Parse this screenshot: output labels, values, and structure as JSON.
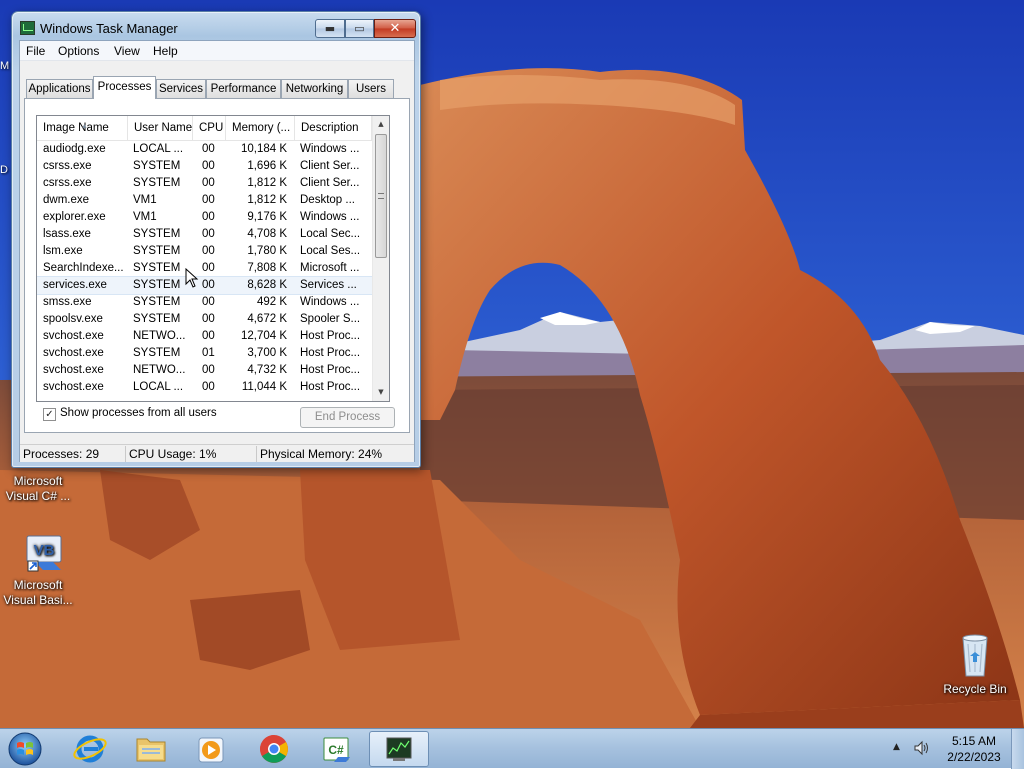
{
  "window": {
    "title": "Windows Task Manager",
    "min_glyph": "▬",
    "max_glyph": "▭",
    "close_glyph": "✕"
  },
  "menu": [
    "File",
    "Options",
    "View",
    "Help"
  ],
  "tabs": [
    "Applications",
    "Processes",
    "Services",
    "Performance",
    "Networking",
    "Users"
  ],
  "active_tab": "Processes",
  "columns": [
    "Image Name",
    "User Name",
    "CPU",
    "Memory (...",
    "Description"
  ],
  "processes": [
    {
      "name": "audiodg.exe",
      "user": "LOCAL ...",
      "cpu": "00",
      "mem": "10,184 K",
      "desc": "Windows ..."
    },
    {
      "name": "csrss.exe",
      "user": "SYSTEM",
      "cpu": "00",
      "mem": "1,696 K",
      "desc": "Client Ser..."
    },
    {
      "name": "csrss.exe",
      "user": "SYSTEM",
      "cpu": "00",
      "mem": "1,812 K",
      "desc": "Client Ser..."
    },
    {
      "name": "dwm.exe",
      "user": "VM1",
      "cpu": "00",
      "mem": "1,812 K",
      "desc": "Desktop ..."
    },
    {
      "name": "explorer.exe",
      "user": "VM1",
      "cpu": "00",
      "mem": "9,176 K",
      "desc": "Windows ..."
    },
    {
      "name": "lsass.exe",
      "user": "SYSTEM",
      "cpu": "00",
      "mem": "4,708 K",
      "desc": "Local Sec..."
    },
    {
      "name": "lsm.exe",
      "user": "SYSTEM",
      "cpu": "00",
      "mem": "1,780 K",
      "desc": "Local Ses..."
    },
    {
      "name": "SearchIndexe...",
      "user": "SYSTEM",
      "cpu": "00",
      "mem": "7,808 K",
      "desc": "Microsoft ..."
    },
    {
      "name": "services.exe",
      "user": "SYSTEM",
      "cpu": "00",
      "mem": "8,628 K",
      "desc": "Services ..."
    },
    {
      "name": "smss.exe",
      "user": "SYSTEM",
      "cpu": "00",
      "mem": "492 K",
      "desc": "Windows ..."
    },
    {
      "name": "spoolsv.exe",
      "user": "SYSTEM",
      "cpu": "00",
      "mem": "4,672 K",
      "desc": "Spooler S..."
    },
    {
      "name": "svchost.exe",
      "user": "NETWO...",
      "cpu": "00",
      "mem": "12,704 K",
      "desc": "Host Proc..."
    },
    {
      "name": "svchost.exe",
      "user": "SYSTEM",
      "cpu": "01",
      "mem": "3,700 K",
      "desc": "Host Proc..."
    },
    {
      "name": "svchost.exe",
      "user": "NETWO...",
      "cpu": "00",
      "mem": "4,732 K",
      "desc": "Host Proc..."
    },
    {
      "name": "svchost.exe",
      "user": "LOCAL ...",
      "cpu": "00",
      "mem": "11,044 K",
      "desc": "Host Proc..."
    }
  ],
  "hovered_row": 8,
  "show_all_users": {
    "label": "Show processes from all users",
    "checked": true,
    "mark": "✓"
  },
  "end_process_label": "End Process",
  "status": {
    "processes": "Processes: 29",
    "cpu": "CPU Usage: 1%",
    "memory": "Physical Memory: 24%"
  },
  "desktop_icons": [
    {
      "label_line1": "Microsoft",
      "label_line2": "Visual C# ...",
      "icon": "visual-csharp-icon"
    },
    {
      "label_line1": "Microsoft",
      "label_line2": "Visual Basi...",
      "icon": "visual-basic-icon"
    },
    {
      "label_line1": "Recycle Bin",
      "icon": "recycle-bin-icon"
    }
  ],
  "vb_icon_text": "VB",
  "edge_letters": [
    "M",
    "D"
  ],
  "taskbar": {
    "apps": [
      "internet-explorer-icon",
      "file-explorer-icon",
      "media-player-icon",
      "chrome-icon",
      "visual-csharp-icon",
      "task-manager-icon"
    ],
    "csharp_text": "C#",
    "time": "5:15 AM",
    "date": "2/22/2023"
  },
  "colors": {
    "sky": "#1b3fb8",
    "rock": "#c0562a",
    "taskbar": "#a7c2df",
    "window_frame": "#aac6e2",
    "close_button": "#c23a22"
  }
}
